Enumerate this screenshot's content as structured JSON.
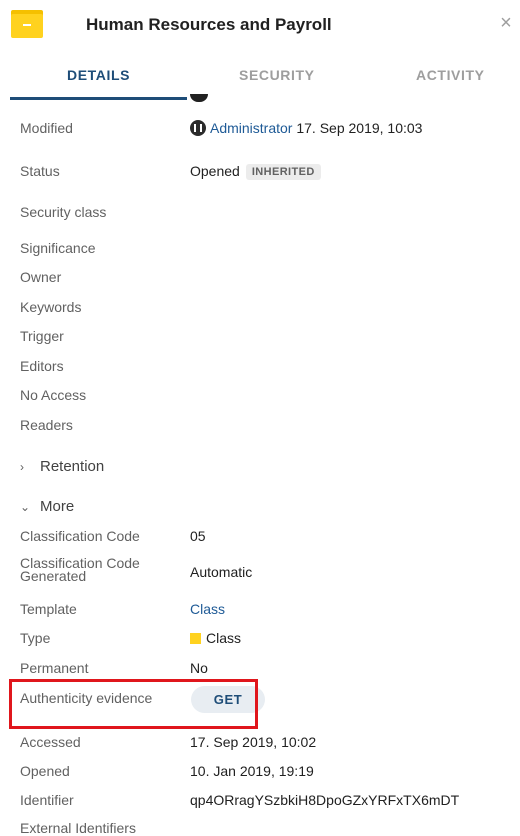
{
  "header": {
    "title": "Human Resources and Payroll",
    "close": "×",
    "folder_color": "#ffd21f"
  },
  "tabs": [
    {
      "label": "DETAILS",
      "active": true
    },
    {
      "label": "SECURITY",
      "active": false
    },
    {
      "label": "ACTIVITY",
      "active": false
    }
  ],
  "details": {
    "modified": {
      "label": "Modified",
      "user": "Administrator",
      "date": "17. Sep 2019, 10:03"
    },
    "status": {
      "label": "Status",
      "value": "Opened",
      "badge": "INHERITED"
    },
    "security_class": {
      "label": "Security class"
    },
    "significance": {
      "label": "Significance"
    },
    "owner": {
      "label": "Owner"
    },
    "keywords": {
      "label": "Keywords"
    },
    "trigger": {
      "label": "Trigger"
    },
    "editors": {
      "label": "Editors"
    },
    "no_access": {
      "label": "No Access"
    },
    "readers": {
      "label": "Readers"
    }
  },
  "sections": {
    "retention": {
      "label": "Retention",
      "chevron": "›"
    },
    "more": {
      "label": "More",
      "chevron": "⌄"
    }
  },
  "more": {
    "classification_code": {
      "label": "Classification Code",
      "value": "05"
    },
    "classification_code_generated": {
      "label_line1": "Classification Code",
      "label_line2": "Generated",
      "value": "Automatic"
    },
    "template": {
      "label": "Template",
      "value": "Class"
    },
    "type": {
      "label": "Type",
      "value": "Class"
    },
    "permanent": {
      "label": "Permanent",
      "value": "No"
    },
    "authenticity": {
      "label": "Authenticity evidence",
      "button": "GET"
    },
    "accessed": {
      "label": "Accessed",
      "value": "17. Sep 2019, 10:02"
    },
    "opened": {
      "label": "Opened",
      "value": "10. Jan 2019, 19:19"
    },
    "identifier": {
      "label": "Identifier",
      "value": "qp4ORragYSzbkiH8DpoGZxYRFxTX6mDT"
    },
    "external_identifiers": {
      "label": "External Identifiers"
    }
  },
  "colors": {
    "accent": "#1e4d78",
    "link": "#1e5a96",
    "highlight": "#e0161c"
  }
}
